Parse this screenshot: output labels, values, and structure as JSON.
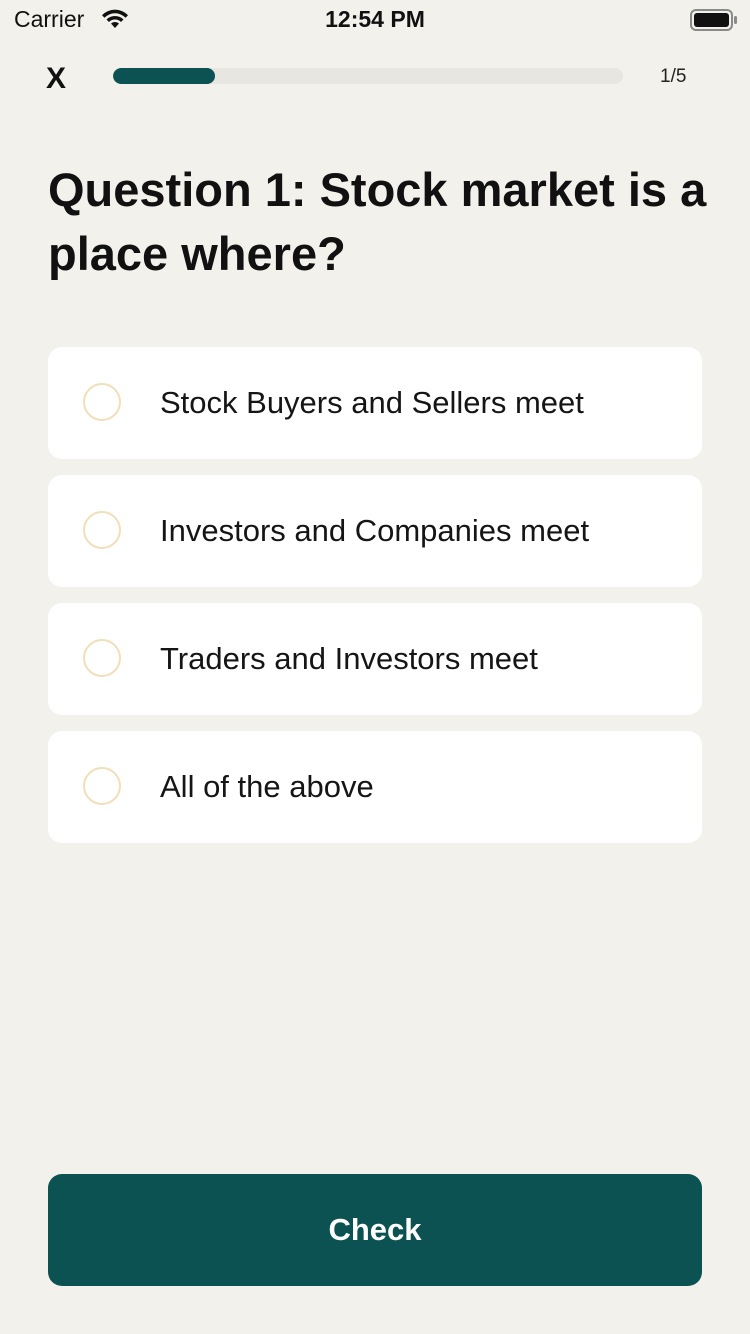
{
  "status_bar": {
    "carrier": "Carrier",
    "time": "12:54 PM"
  },
  "header": {
    "close_label": "X",
    "progress": {
      "current": 1,
      "total": 5,
      "fraction": 0.2,
      "label": "1/5"
    }
  },
  "question": {
    "title": "Question 1: Stock market is a place where?"
  },
  "options": [
    {
      "label": "Stock Buyers and Sellers meet"
    },
    {
      "label": "Investors and Companies meet"
    },
    {
      "label": "Traders and Investors meet"
    },
    {
      "label": "All of the above"
    }
  ],
  "actions": {
    "check_label": "Check"
  },
  "colors": {
    "background": "#F3F1EC",
    "primary": "#0C5252",
    "radio_border": "#F2DFB7"
  }
}
